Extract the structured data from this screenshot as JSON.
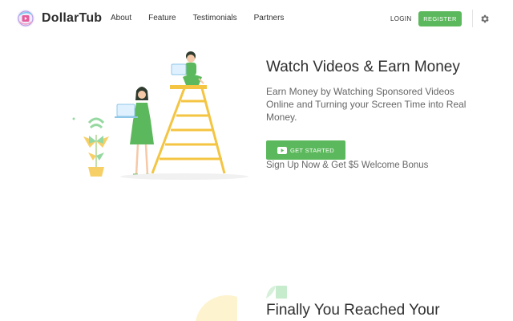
{
  "header": {
    "brand": "DollarTub",
    "nav": [
      "About",
      "Feature",
      "Testimonials",
      "Partners"
    ],
    "login": "LOGIN",
    "register": "REGISTER"
  },
  "hero": {
    "title": "Watch Videos & Earn Money",
    "subtitle": "Earn Money by Watching Sponsored Videos Online and Turning your Screen Time into Real Money.",
    "cta_label": "GET STARTED",
    "bonus_text": "Sign Up Now & Get $5 Welcome Bonus"
  },
  "next_section": {
    "title": "Finally You Reached Your"
  },
  "icons": {
    "logo": "play-logo-icon",
    "settings": "gear-icon",
    "cta": "youtube-play-icon"
  },
  "colors": {
    "accent_green": "#5cb85c",
    "illustration_yellow": "#f4c542",
    "text_dark": "#2f2f2f",
    "text_muted": "#666666"
  }
}
